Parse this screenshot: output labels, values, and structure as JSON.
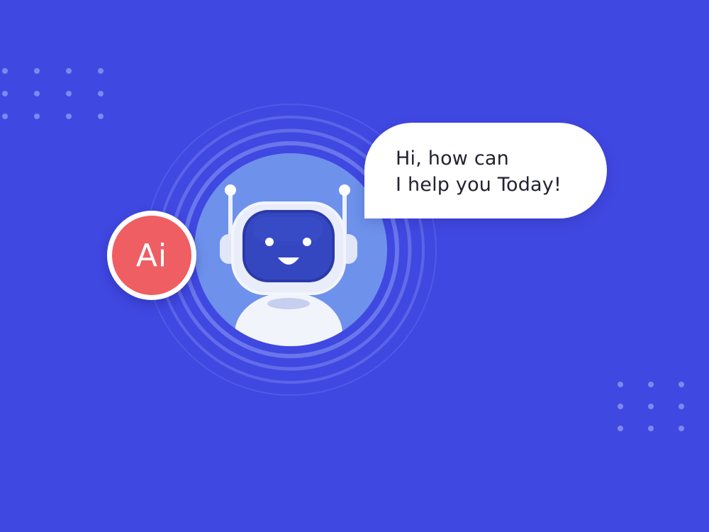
{
  "chat_bubble": {
    "line1": "Hi, how can",
    "line2": "I help you Today!"
  },
  "badge": {
    "label": "Ai"
  },
  "illustration": {
    "icon": "robot-icon",
    "expression": "smiling"
  },
  "colors": {
    "background": "#4048e2",
    "badge": "#ef5e62",
    "halo": "#6e92ec",
    "robot_visor": "#2b3aa8"
  }
}
